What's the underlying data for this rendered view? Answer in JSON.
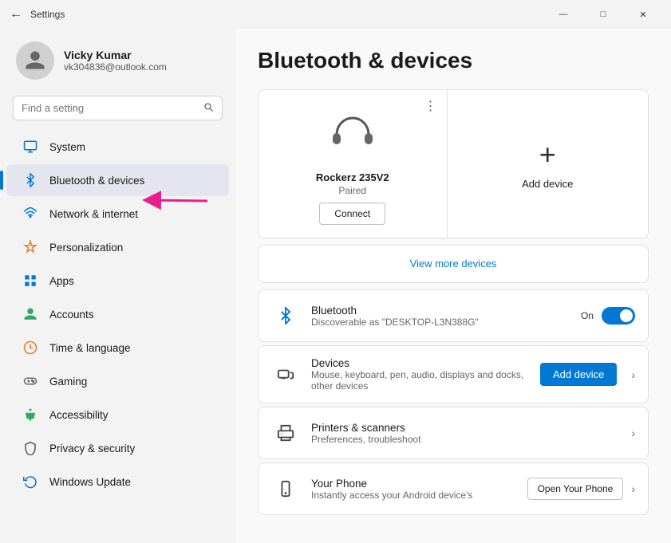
{
  "window": {
    "title": "Settings",
    "back_icon": "←",
    "controls": {
      "minimize": "—",
      "maximize": "□",
      "close": "✕"
    }
  },
  "sidebar": {
    "profile": {
      "name": "Vicky Kumar",
      "email": "vk304836@outlook.com"
    },
    "search": {
      "placeholder": "Find a setting"
    },
    "nav_items": [
      {
        "id": "system",
        "label": "System",
        "active": false
      },
      {
        "id": "bluetooth",
        "label": "Bluetooth & devices",
        "active": true
      },
      {
        "id": "network",
        "label": "Network & internet",
        "active": false
      },
      {
        "id": "personalization",
        "label": "Personalization",
        "active": false
      },
      {
        "id": "apps",
        "label": "Apps",
        "active": false
      },
      {
        "id": "accounts",
        "label": "Accounts",
        "active": false
      },
      {
        "id": "time",
        "label": "Time & language",
        "active": false
      },
      {
        "id": "gaming",
        "label": "Gaming",
        "active": false
      },
      {
        "id": "accessibility",
        "label": "Accessibility",
        "active": false
      },
      {
        "id": "privacy",
        "label": "Privacy & security",
        "active": false
      },
      {
        "id": "update",
        "label": "Windows Update",
        "active": false
      }
    ]
  },
  "content": {
    "page_title": "Bluetooth & devices",
    "device_card": {
      "name": "Rockerz 235V2",
      "status": "Paired",
      "connect_label": "Connect",
      "menu_icon": "⋮"
    },
    "add_device_card": {
      "icon": "+",
      "label": "Add device"
    },
    "view_more": {
      "label": "View more devices"
    },
    "bluetooth_row": {
      "title": "Bluetooth",
      "subtitle": "Discoverable as \"DESKTOP-L3N388G\"",
      "toggle_label": "On"
    },
    "devices_row": {
      "title": "Devices",
      "subtitle": "Mouse, keyboard, pen, audio, displays and docks, other devices",
      "add_label": "Add device"
    },
    "printers_row": {
      "title": "Printers & scanners",
      "subtitle": "Preferences, troubleshoot"
    },
    "phone_row": {
      "title": "Your Phone",
      "subtitle": "Instantly access your Android device's",
      "action_label": "Open Your Phone"
    }
  }
}
